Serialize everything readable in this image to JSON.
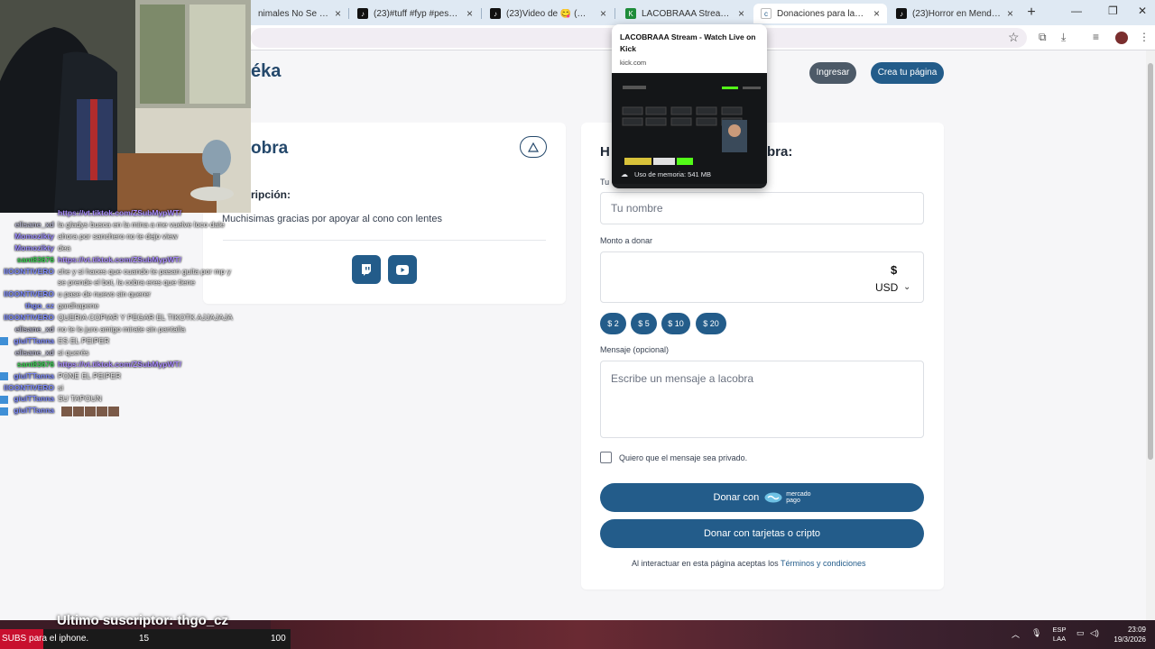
{
  "browser": {
    "tabs": [
      {
        "title": "nimales No Se Contagi",
        "favicon": "",
        "active": false
      },
      {
        "title": "(23)#tuff #fyp #pesopluma #",
        "favicon": "tiktok",
        "active": false
      },
      {
        "title": "(23)Video de 😋 (@alandelu",
        "favicon": "tiktok",
        "active": false
      },
      {
        "title": "LACOBRAAA Stream - Watch",
        "favicon": "kick",
        "active": false
      },
      {
        "title": "Donaciones para lacobra | C",
        "favicon": "cafecito",
        "active": true
      },
      {
        "title": "(23)Horror en Mendoza: La v",
        "favicon": "tiktok",
        "active": false
      }
    ],
    "new_tab": "+",
    "close": "×"
  },
  "preview": {
    "title": "LACOBRAAA Stream - Watch Live on Kick",
    "domain": "kick.com",
    "memory": "Uso de memoria: 541 MB"
  },
  "site": {
    "logo": "éka",
    "login": "Ingresar",
    "create": "Crea tu página"
  },
  "creator": {
    "name": "obra",
    "desc_label": "ripción:",
    "desc_text": "Muchisimas gracias por apoyar al cono con lentes"
  },
  "form": {
    "title_left": "H",
    "title_right": "bra:",
    "name_label": "Tu",
    "name_placeholder": "Tu nombre",
    "amount_label": "Monto a donar",
    "currency_symbol": "$",
    "currency": "USD",
    "chips": [
      "$ 2",
      "$ 5",
      "$ 10",
      "$ 20"
    ],
    "message_label": "Mensaje (opcional)",
    "message_placeholder": "Escribe un mensaje a lacobra",
    "private_label": "Quiero que el mensaje sea privado.",
    "donate_mp": "Donar con",
    "mp_logo_top": "mercado",
    "mp_logo_bottom": "pago",
    "donate_crypto": "Donar con tarjetas o cripto",
    "terms_prefix": "Al interactuar en esta página aceptas los",
    "terms_link": "Términos y condiciones"
  },
  "chat": [
    {
      "user": "",
      "msg": "https://vt.tiktok.com/ZSubMypWT/",
      "color": "#9b6bff"
    },
    {
      "user": "elisane_xd",
      "msg": "la gladys busca en la mina a me vuelve loco dale",
      "color": "#b0b0c8"
    },
    {
      "user": "Momozikty",
      "msg": "ahora por sanchero no te dejo view",
      "color": "#9b8cff"
    },
    {
      "user": "Momozikty",
      "msg": "dea",
      "color": "#9b8cff"
    },
    {
      "user": "sant83676",
      "msg": "https://vt.tiktok.com/ZSubMypWT/",
      "color": "#39d353"
    },
    {
      "user": "IIOONTIVERO",
      "msg": "che y si haces que cuando te pasan guita por mp y",
      "color": "#7f8cff"
    },
    {
      "user": "",
      "msg": "se prende el bot, la cobra eres que tiene",
      "color": "#7f8cff"
    },
    {
      "user": "IIOONTIVERO",
      "msg": "u pase de nuevo sin querer",
      "color": "#7f8cff"
    },
    {
      "user": "thgo_cz",
      "msg": "gardhapene",
      "color": "#7f8cff"
    },
    {
      "user": "IIOONTIVERO",
      "msg": "QUERIA COPIAR Y PEGAR EL TIKOTK AJJAJAJA",
      "color": "#7f8cff"
    },
    {
      "user": "elisane_xd",
      "msg": "no te lo juro amigo mirate sin pantalla",
      "color": "#b0b0c8"
    },
    {
      "user": "giulTTanna",
      "msg": "ES EL PEIPER",
      "color": "#7f8cff"
    },
    {
      "user": "elisane_xd",
      "msg": "si querés",
      "color": "#b0b0c8"
    },
    {
      "user": "sant83676",
      "msg": "https://vt.tiktok.com/ZSubMypWT/",
      "color": "#39d353"
    },
    {
      "user": "giulTTanna",
      "msg": "PONE EL PEIPER",
      "color": "#7f8cff"
    },
    {
      "user": "IIOONTIVERO",
      "msg": "si",
      "color": "#7f8cff"
    },
    {
      "user": "giulTTanna",
      "msg": "SU TAPOUN",
      "color": "#7f8cff"
    },
    {
      "user": "giulTTanna",
      "msg": "",
      "color": "#7f8cff"
    }
  ],
  "stream": {
    "last_sub": "Ultimo suscriptor: thgo_cz",
    "subs_label": "SUBS para el iphone.",
    "subs_current": "15",
    "subs_goal": "100",
    "subs_progress": 0.15
  },
  "taskbar": {
    "lang_top": "ESP",
    "lang_bottom": "LAA",
    "time": "23:09",
    "date": "19/3/2026"
  },
  "colors": {
    "primary": "#235c8a",
    "logo": "#24486b",
    "dark_button": "#4d5a68"
  }
}
